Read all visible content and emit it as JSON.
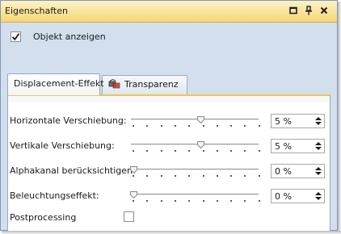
{
  "window": {
    "title": "Eigenschaften"
  },
  "titlebar_buttons": [
    "restore-icon",
    "pin-icon",
    "close-icon"
  ],
  "show_object": {
    "label": "Objekt anzeigen",
    "checked": true
  },
  "tabs": [
    {
      "label": "Displacement-Effekt",
      "active": true
    },
    {
      "label": "Transparenz",
      "active": false,
      "icon": "transparency-icon"
    }
  ],
  "rows": [
    {
      "label": "Horizontale Verschiebung:",
      "value": "5 %",
      "slider_fraction": 0.55
    },
    {
      "label": "Vertikale Verschiebung:",
      "value": "5 %",
      "slider_fraction": 0.55
    },
    {
      "label": "Alphakanal berücksichtigen:",
      "value": "0 %",
      "slider_fraction": 0.0
    },
    {
      "label": "Beleuchtungseffekt:",
      "value": "0 %",
      "slider_fraction": 0.0
    }
  ],
  "postprocessing": {
    "label": "Postprocessing",
    "checked": false
  },
  "colors": {
    "title_gradient_top": "#fdf3c7",
    "title_gradient_bottom": "#f5d776",
    "background": "#d4dfee",
    "tab_accent": "#f0c74f"
  }
}
